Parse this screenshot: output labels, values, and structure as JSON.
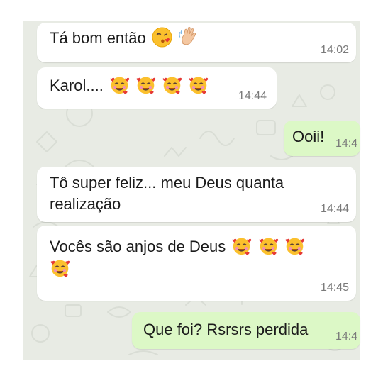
{
  "messages": [
    {
      "direction": "incoming",
      "text": "Tá bom então",
      "emoji": [
        "face-blowing-kiss-icon",
        "waving-hand-icon"
      ],
      "time": "14:02"
    },
    {
      "direction": "incoming",
      "text": "Karol....",
      "emoji": [
        "smiling-face-with-hearts-icon",
        "smiling-face-with-hearts-icon",
        "smiling-face-with-hearts-icon",
        "smiling-face-with-hearts-icon"
      ],
      "time": "14:44"
    },
    {
      "direction": "outgoing",
      "text": "Ooii!",
      "emoji": [],
      "time": "14:4"
    },
    {
      "direction": "incoming",
      "text": "Tô super feliz... meu Deus quanta realização",
      "emoji": [],
      "time": "14:44"
    },
    {
      "direction": "incoming",
      "text": "Vocês são anjos de Deus",
      "emoji": [
        "smiling-face-with-hearts-icon",
        "smiling-face-with-hearts-icon",
        "smiling-face-with-hearts-icon",
        "smiling-face-with-hearts-icon"
      ],
      "time": "14:45"
    },
    {
      "direction": "outgoing",
      "text": "Que foi? Rsrsrs perdida",
      "emoji": [],
      "time": "14:4"
    }
  ],
  "colors": {
    "wallpaper": "#e8ebe4",
    "incoming_bubble": "#ffffff",
    "outgoing_bubble": "#dcf8c6",
    "timestamp": "#7a7a7a"
  }
}
